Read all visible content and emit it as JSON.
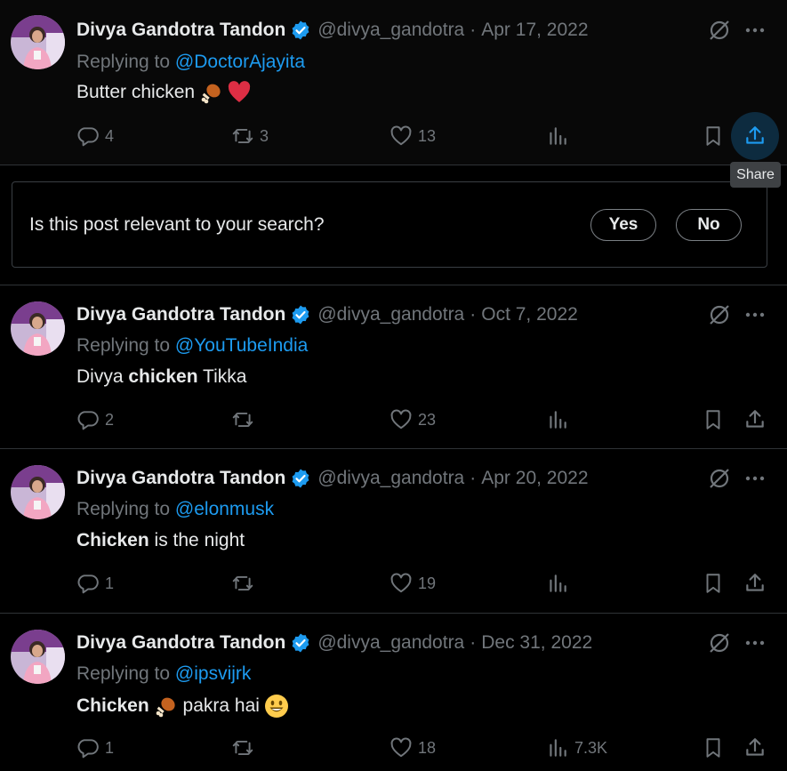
{
  "colors": {
    "accent": "#1d9bf0",
    "muted": "#71767b",
    "text": "#e7e9ea",
    "like_red": "#e0245e"
  },
  "tweets": [
    {
      "name": "Divya Gandotra Tandon",
      "handle": "@divya_gandotra",
      "separator": "·",
      "date": "Apr 17, 2022",
      "replying_prefix": "Replying to ",
      "mention": "@DoctorAjayita",
      "text_pre": "",
      "text_bold": "",
      "text_post": "Butter chicken",
      "emojis": [
        "poultry-leg-emoji",
        "red-heart-emoji"
      ],
      "replies": "4",
      "reposts": "3",
      "likes": "13",
      "views": ""
    },
    {
      "name": "Divya Gandotra Tandon",
      "handle": "@divya_gandotra",
      "separator": "·",
      "date": "Oct 7, 2022",
      "replying_prefix": "Replying to ",
      "mention": "@YouTubeIndia",
      "text_pre": "Divya ",
      "text_bold": "chicken",
      "text_post": " Tikka",
      "emojis": [],
      "replies": "2",
      "reposts": "",
      "likes": "23",
      "views": ""
    },
    {
      "name": "Divya Gandotra Tandon",
      "handle": "@divya_gandotra",
      "separator": "·",
      "date": "Apr 20, 2022",
      "replying_prefix": "Replying to ",
      "mention": "@elonmusk",
      "text_pre": "",
      "text_bold": "Chicken",
      "text_post": " is the night",
      "emojis": [],
      "replies": "1",
      "reposts": "",
      "likes": "19",
      "views": ""
    },
    {
      "name": "Divya Gandotra Tandon",
      "handle": "@divya_gandotra",
      "separator": "·",
      "date": "Dec 31, 2022",
      "replying_prefix": "Replying to ",
      "mention": "@ipsvijrk",
      "text_pre": "",
      "text_bold": "Chicken",
      "text_post": " pakra hai",
      "emojis": [
        "poultry-leg-emoji",
        "smiley-emoji"
      ],
      "replies": "1",
      "reposts": "",
      "likes": "18",
      "views": "7.3K"
    }
  ],
  "tooltip": {
    "label": "Share"
  },
  "survey": {
    "question": "Is this post relevant to your search?",
    "yes_label": "Yes",
    "no_label": "No"
  }
}
